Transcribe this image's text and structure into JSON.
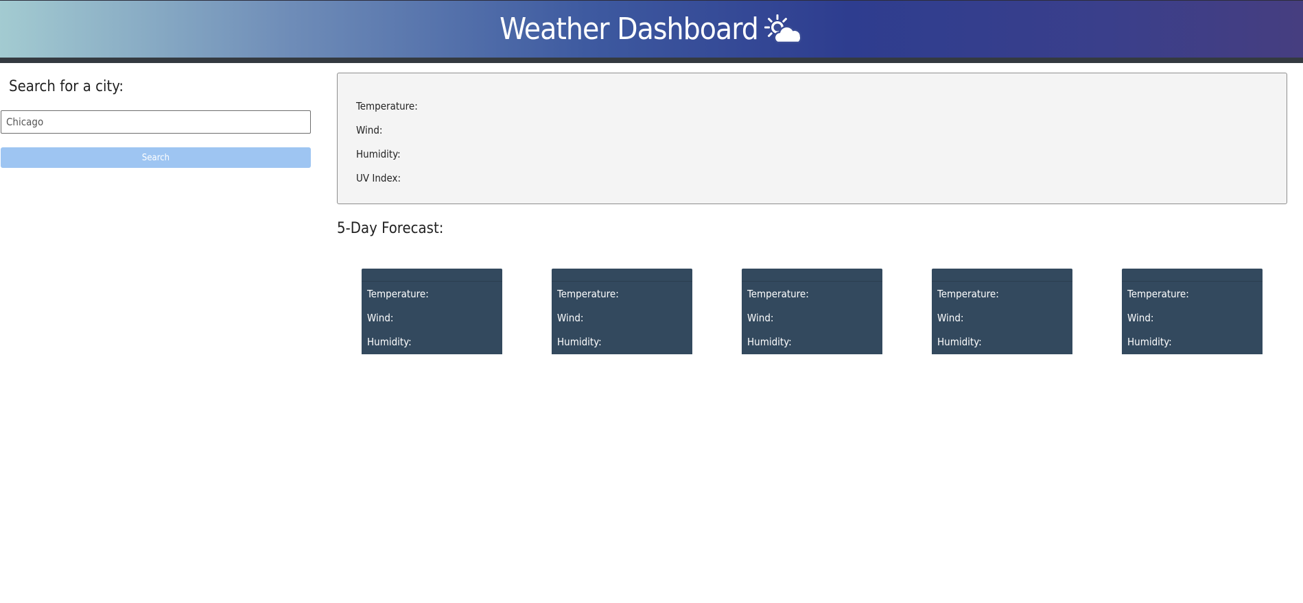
{
  "header": {
    "title": "Weather Dashboard",
    "icon": "sun-behind-cloud-icon"
  },
  "search": {
    "heading": "Search for a city:",
    "input_value": "Chicago",
    "button_label": "Search"
  },
  "current": {
    "temperature_label": "Temperature:",
    "wind_label": "Wind:",
    "humidity_label": "Humidity:",
    "uv_label": "UV Index:"
  },
  "forecast": {
    "heading": "5-Day Forecast:",
    "cards": [
      {
        "temperature_label": "Temperature:",
        "wind_label": "Wind:",
        "humidity_label": "Humidity:"
      },
      {
        "temperature_label": "Temperature:",
        "wind_label": "Wind:",
        "humidity_label": "Humidity:"
      },
      {
        "temperature_label": "Temperature:",
        "wind_label": "Wind:",
        "humidity_label": "Humidity:"
      },
      {
        "temperature_label": "Temperature:",
        "wind_label": "Wind:",
        "humidity_label": "Humidity:"
      },
      {
        "temperature_label": "Temperature:",
        "wind_label": "Wind:",
        "humidity_label": "Humidity:"
      }
    ]
  },
  "colors": {
    "header_start": "#a3cbd1",
    "header_end": "#463e80",
    "header_bar": "#343a40",
    "button_bg": "#9ec5f2",
    "card_bg": "#33495e",
    "current_bg": "#f4f4f4"
  }
}
